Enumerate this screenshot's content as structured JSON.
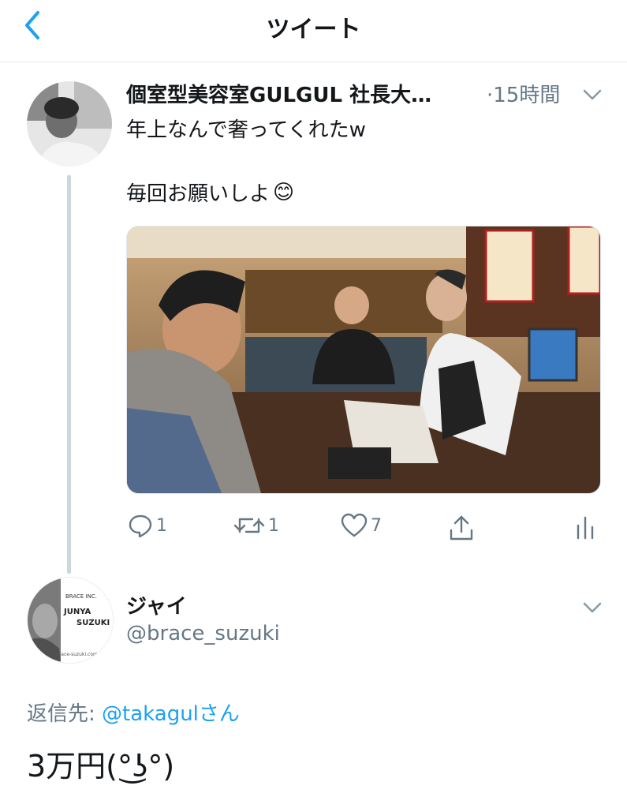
{
  "header": {
    "title": "ツイート"
  },
  "tweet": {
    "display_name": "個室型美容室GULGUL 社長大…",
    "time": "·15時間",
    "line1": "年上なんで奢ってくれたw",
    "line2": "毎回お願いしよ",
    "emoji": "😊",
    "actions": {
      "reply_count": "1",
      "retweet_count": "1",
      "like_count": "7"
    }
  },
  "reply": {
    "display_name": "ジャイ",
    "handle": "@brace_suzuki",
    "avatar_text": {
      "brand": "BRACE INC.",
      "first": "JUNYA",
      "last": "SUZUKI",
      "url": "brace-suzuki.com"
    },
    "reply_to_label": "返信先:",
    "reply_to_user": "@takagul",
    "reply_to_suffix": "さん",
    "text": "3万円(°͜ʖ°)"
  },
  "colors": {
    "accent": "#1da1f2",
    "muted": "#657786",
    "divider": "#e1e8ed"
  }
}
